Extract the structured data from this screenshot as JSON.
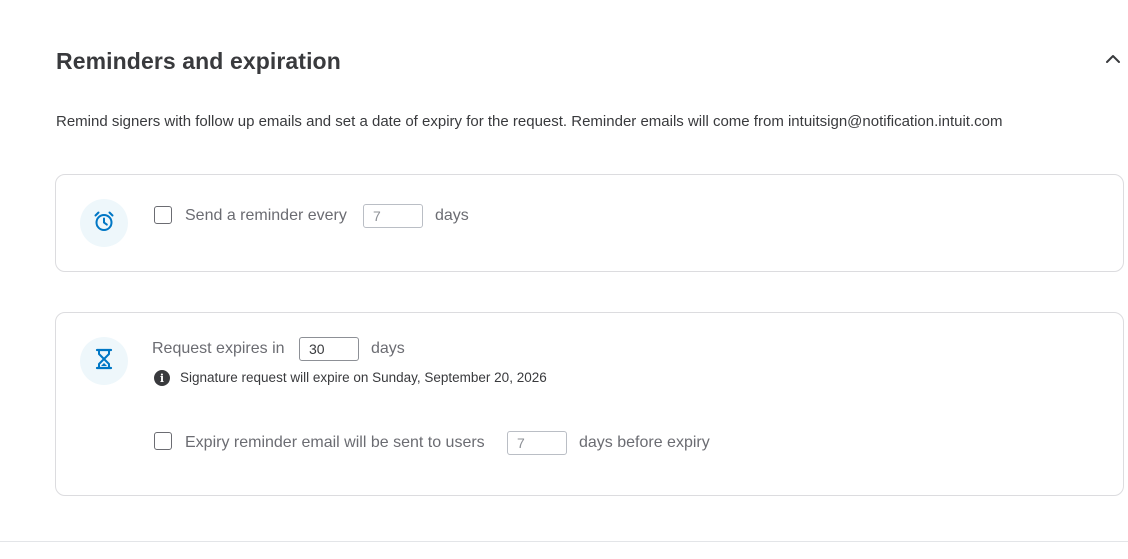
{
  "section": {
    "title": "Reminders and expiration",
    "description": "Remind signers with follow up emails and set a date of expiry for the request. Reminder emails will come from intuitsign@notification.intuit.com"
  },
  "reminder": {
    "label_before": "Send a reminder every",
    "value": "7",
    "label_after": "days",
    "checked": false
  },
  "expiration": {
    "label_before": "Request expires in",
    "value": "30",
    "label_after": "days",
    "info_text": "Signature request will expire on Sunday, September 20, 2026"
  },
  "expiry_reminder": {
    "label_before": "Expiry reminder email will be sent to users",
    "value": "7",
    "label_after": "days before expiry",
    "checked": false
  },
  "colors": {
    "accent": "#0077c5",
    "icon_bg": "#eef7fb",
    "border": "#dcdcdf"
  },
  "icons": {
    "collapse": "chevron-up-icon",
    "reminder": "alarm-clock-icon",
    "expiration": "hourglass-icon",
    "info": "info-icon"
  }
}
